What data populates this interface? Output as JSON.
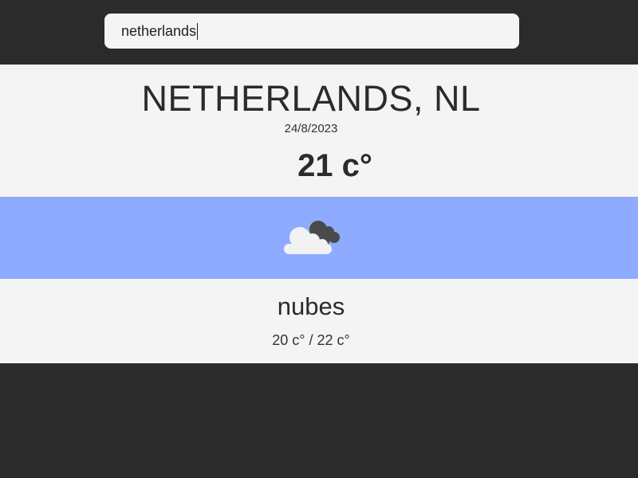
{
  "search": {
    "value": "netherlands"
  },
  "weather": {
    "location": "NETHERLANDS, NL",
    "date": "24/8/2023",
    "temperature": "21 c°",
    "icon": "cloudy-icon",
    "description": "nubes",
    "range": "20 c° / 22 c°"
  },
  "colors": {
    "background": "#2b2b2b",
    "panel": "#f3f4f3",
    "icon_band": "#8eabff"
  }
}
